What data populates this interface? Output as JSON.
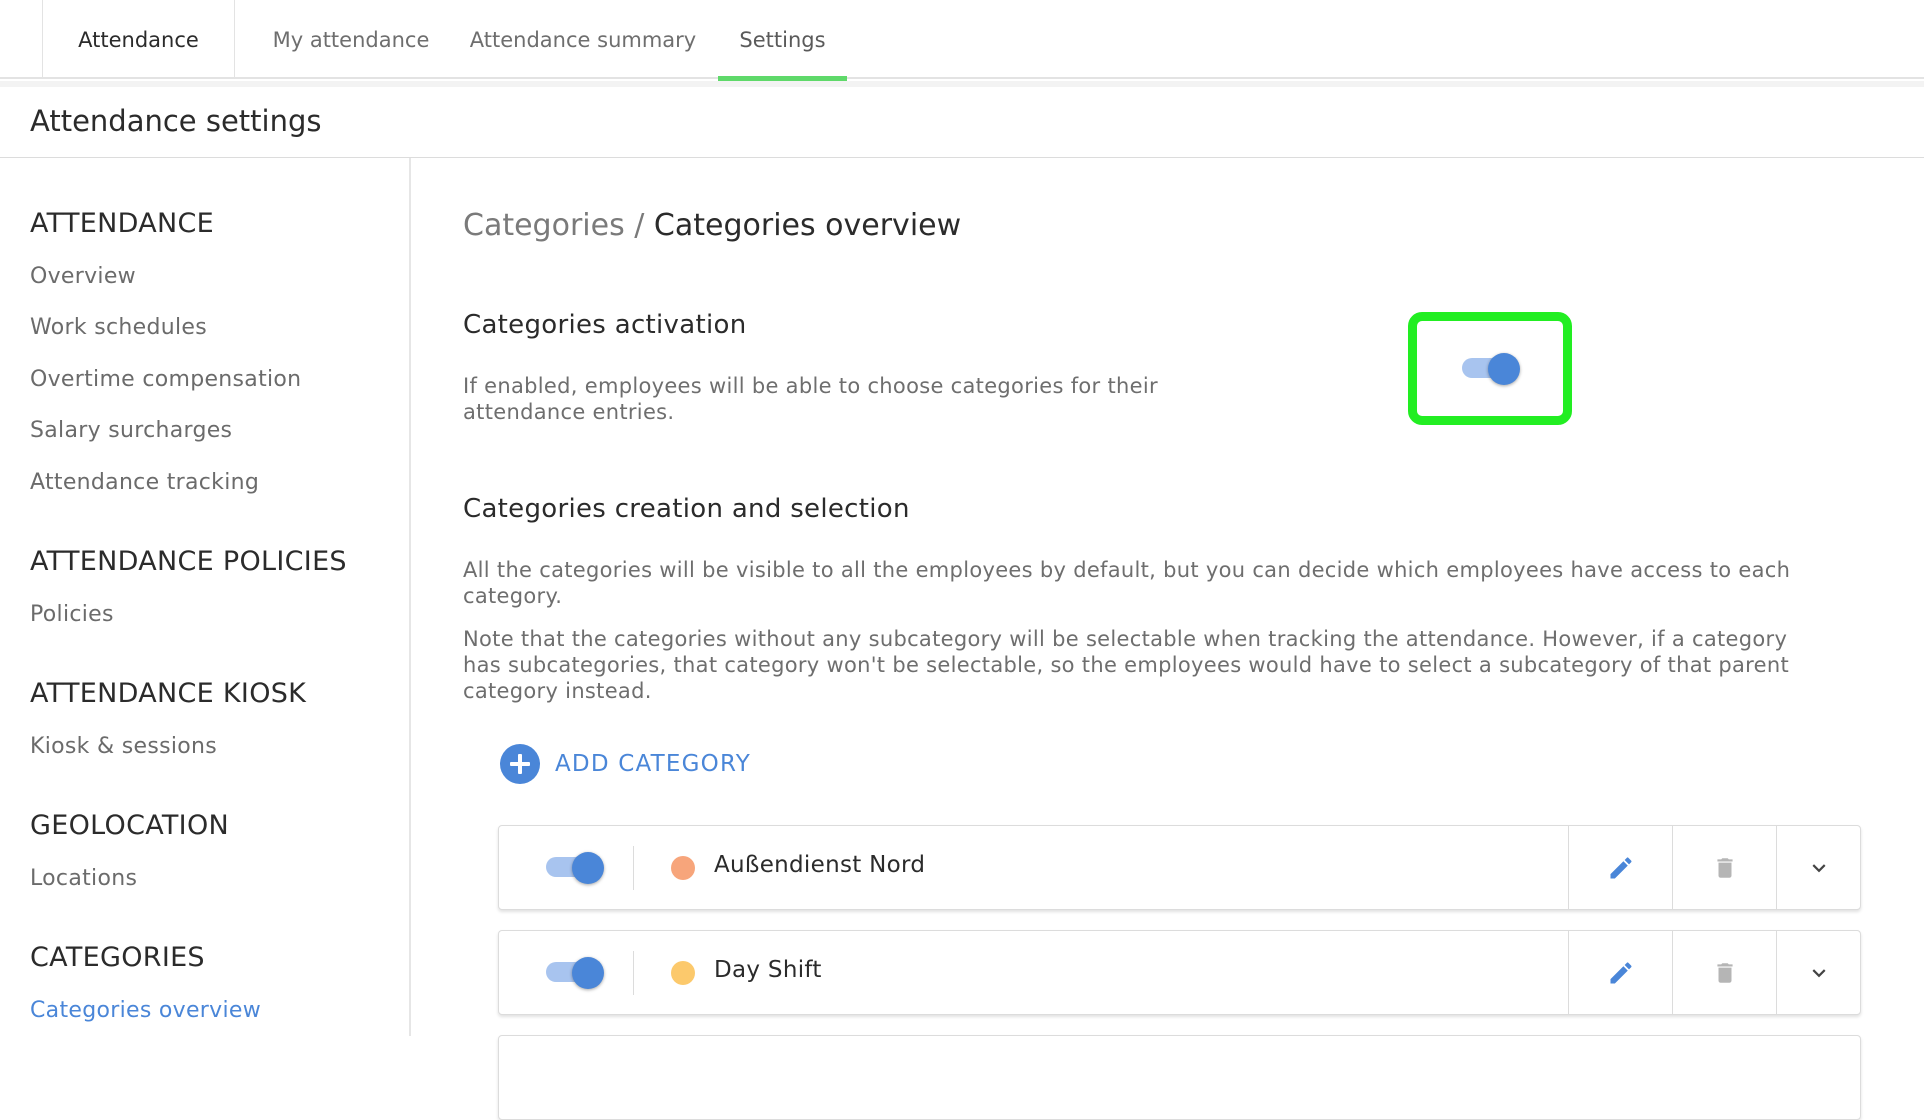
{
  "top_tabs": {
    "app": "Attendance",
    "items": [
      {
        "label": "My attendance",
        "active": false
      },
      {
        "label": "Attendance summary",
        "active": false
      },
      {
        "label": "Settings",
        "active": true
      }
    ]
  },
  "page": {
    "title": "Attendance settings"
  },
  "sidebar": {
    "sections": [
      {
        "title": "ATTENDANCE",
        "items": [
          "Overview",
          "Work schedules",
          "Overtime compensation",
          "Salary surcharges",
          "Attendance tracking"
        ]
      },
      {
        "title": "ATTENDANCE POLICIES",
        "items": [
          "Policies"
        ]
      },
      {
        "title": "ATTENDANCE KIOSK",
        "items": [
          "Kiosk & sessions"
        ]
      },
      {
        "title": "GEOLOCATION",
        "items": [
          "Locations"
        ]
      },
      {
        "title": "CATEGORIES",
        "items": [
          "Categories overview"
        ]
      }
    ],
    "active_item": "Categories overview"
  },
  "main": {
    "breadcrumb": {
      "parent": "Categories",
      "separator": "/",
      "current": "Categories overview"
    },
    "activation": {
      "title": "Categories activation",
      "description_line1": "If enabled, employees will be able to choose categories for their",
      "description_line2": "attendance entries.",
      "enabled": true
    },
    "creation": {
      "title": "Categories creation and selection",
      "para1_line1": "All the categories will be visible to all the employees by default, but you can decide which employees have access to each",
      "para1_line2": "category.",
      "para2_line1": "Note that the categories without any subcategory will be selectable when tracking the attendance. However, if a category",
      "para2_line2": "has subcategories, that category won't be selectable, so the employees would have to select a subcategory of that parent",
      "para2_line3": "category instead."
    },
    "add_category_label": "ADD CATEGORY",
    "categories": [
      {
        "name": "Außendienst Nord",
        "color": "#f7a57b",
        "enabled": true
      },
      {
        "name": "Day Shift",
        "color": "#fcc96c",
        "enabled": true
      }
    ]
  },
  "colors": {
    "accent": "#4a86d8",
    "tab_underline": "#5fd96a",
    "highlight": "#22ee22"
  },
  "icons": {
    "edit": "pencil-icon",
    "delete": "trash-icon",
    "expand": "chevron-down-icon",
    "add": "plus-circle-icon"
  }
}
